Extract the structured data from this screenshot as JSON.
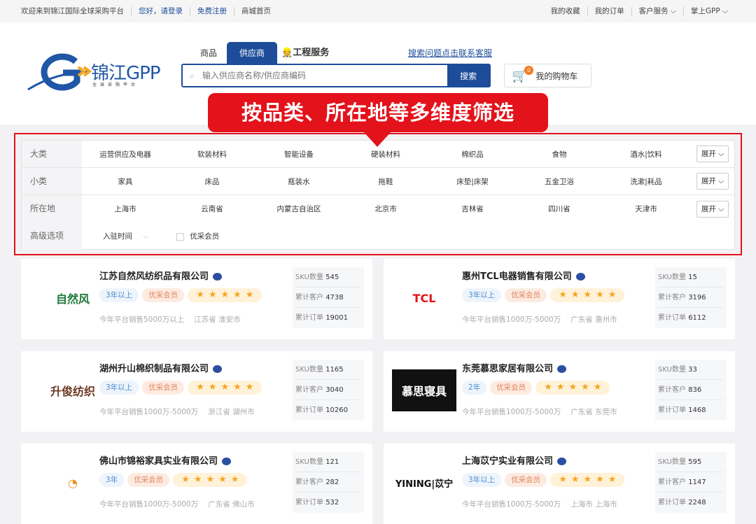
{
  "topbar": {
    "welcome": "欢迎来到锦江国际全球采购平台",
    "login": "您好，请登录",
    "register": "免费注册",
    "home": "商城首页",
    "right": [
      "我的收藏",
      "我的订单",
      "客户服务 ⌵",
      "掌上GPP ⌵"
    ]
  },
  "logo": {
    "title": "锦江GPP",
    "subtitle": "全球采购平台"
  },
  "tabs": [
    "商品",
    "供应商",
    "工程服务"
  ],
  "help_link": "搜索问题点击联系客服",
  "search": {
    "placeholder": "输入供应商名称/供应商编码",
    "button": "搜索"
  },
  "cart": {
    "count": "0",
    "label": "我的购物车"
  },
  "callout": "按品类、所在地等多维度筛选",
  "filters": [
    {
      "label": "大类",
      "options": [
        "运营供应及电器",
        "软装材料",
        "智能设备",
        "硬装材料",
        "棉织品",
        "食物",
        "酒水|饮料"
      ],
      "expand": "展开 ⌵"
    },
    {
      "label": "小类",
      "options": [
        "家具",
        "床品",
        "瓶装水",
        "拖鞋",
        "床垫|床架",
        "五金卫浴",
        "洗漱|耗品"
      ],
      "expand": "展开 ⌵"
    },
    {
      "label": "所在地",
      "options": [
        "上海市",
        "云南省",
        "内蒙古自治区",
        "北京市",
        "吉林省",
        "四川省",
        "天津市"
      ],
      "expand": "展开 ⌵"
    }
  ],
  "advanced": {
    "label": "高级选项",
    "time": "入驻时间",
    "member": "优采会员"
  },
  "stat_labels": {
    "sku": "SKU数量",
    "customers": "累计客户",
    "orders": "累计订单"
  },
  "suppliers": [
    {
      "name": "江苏自然风纺织品有限公司",
      "years": "3年以上",
      "member": "优采会员",
      "stars": 5,
      "sales": "今年平台销售5000万以上",
      "location": "江苏省 淮安市",
      "sku": "545",
      "customers": "4738",
      "orders": "19001",
      "logo": "自然风",
      "logo_color": "#1e7a3a"
    },
    {
      "name": "惠州TCL电器销售有限公司",
      "years": "3年以上",
      "member": "优采会员",
      "stars": 5,
      "sales": "今年平台销售1000万-5000万",
      "location": "广东省 惠州市",
      "sku": "15",
      "customers": "3196",
      "orders": "6112",
      "logo": "TCL",
      "logo_color": "#e3121b"
    },
    {
      "name": "湖州升山棉织制品有限公司",
      "years": "3年以上",
      "member": "优采会员",
      "stars": 5,
      "sales": "今年平台销售1000万-5000万",
      "location": "浙江省 湖州市",
      "sku": "1165",
      "customers": "3040",
      "orders": "10260",
      "logo": "升俊纺织",
      "logo_color": "#6b3a26"
    },
    {
      "name": "东莞慕思家居有限公司",
      "years": "2年",
      "member": "优采会员",
      "stars": 5,
      "sales": "今年平台销售1000万-5000万",
      "location": "广东省 东莞市",
      "sku": "33",
      "customers": "836",
      "orders": "1468",
      "logo": "慕思寝具",
      "logo_color": "#111111"
    },
    {
      "name": "佛山市锦裕家具实业有限公司",
      "years": "3年",
      "member": "优采会员",
      "stars": 5,
      "sales": "今年平台销售1000万-5000万",
      "location": "广东省 佛山市",
      "sku": "121",
      "customers": "282",
      "orders": "532",
      "logo": "◔",
      "logo_color": "#f08a1c"
    },
    {
      "name": "上海苡宁实业有限公司",
      "years": "3年以上",
      "member": "优采会员",
      "stars": 5,
      "sales": "今年平台销售1000万-5000万",
      "location": "上海市 上海市",
      "sku": "595",
      "customers": "1147",
      "orders": "2248",
      "logo": "YINING|苡宁",
      "logo_color": "#111111"
    }
  ]
}
